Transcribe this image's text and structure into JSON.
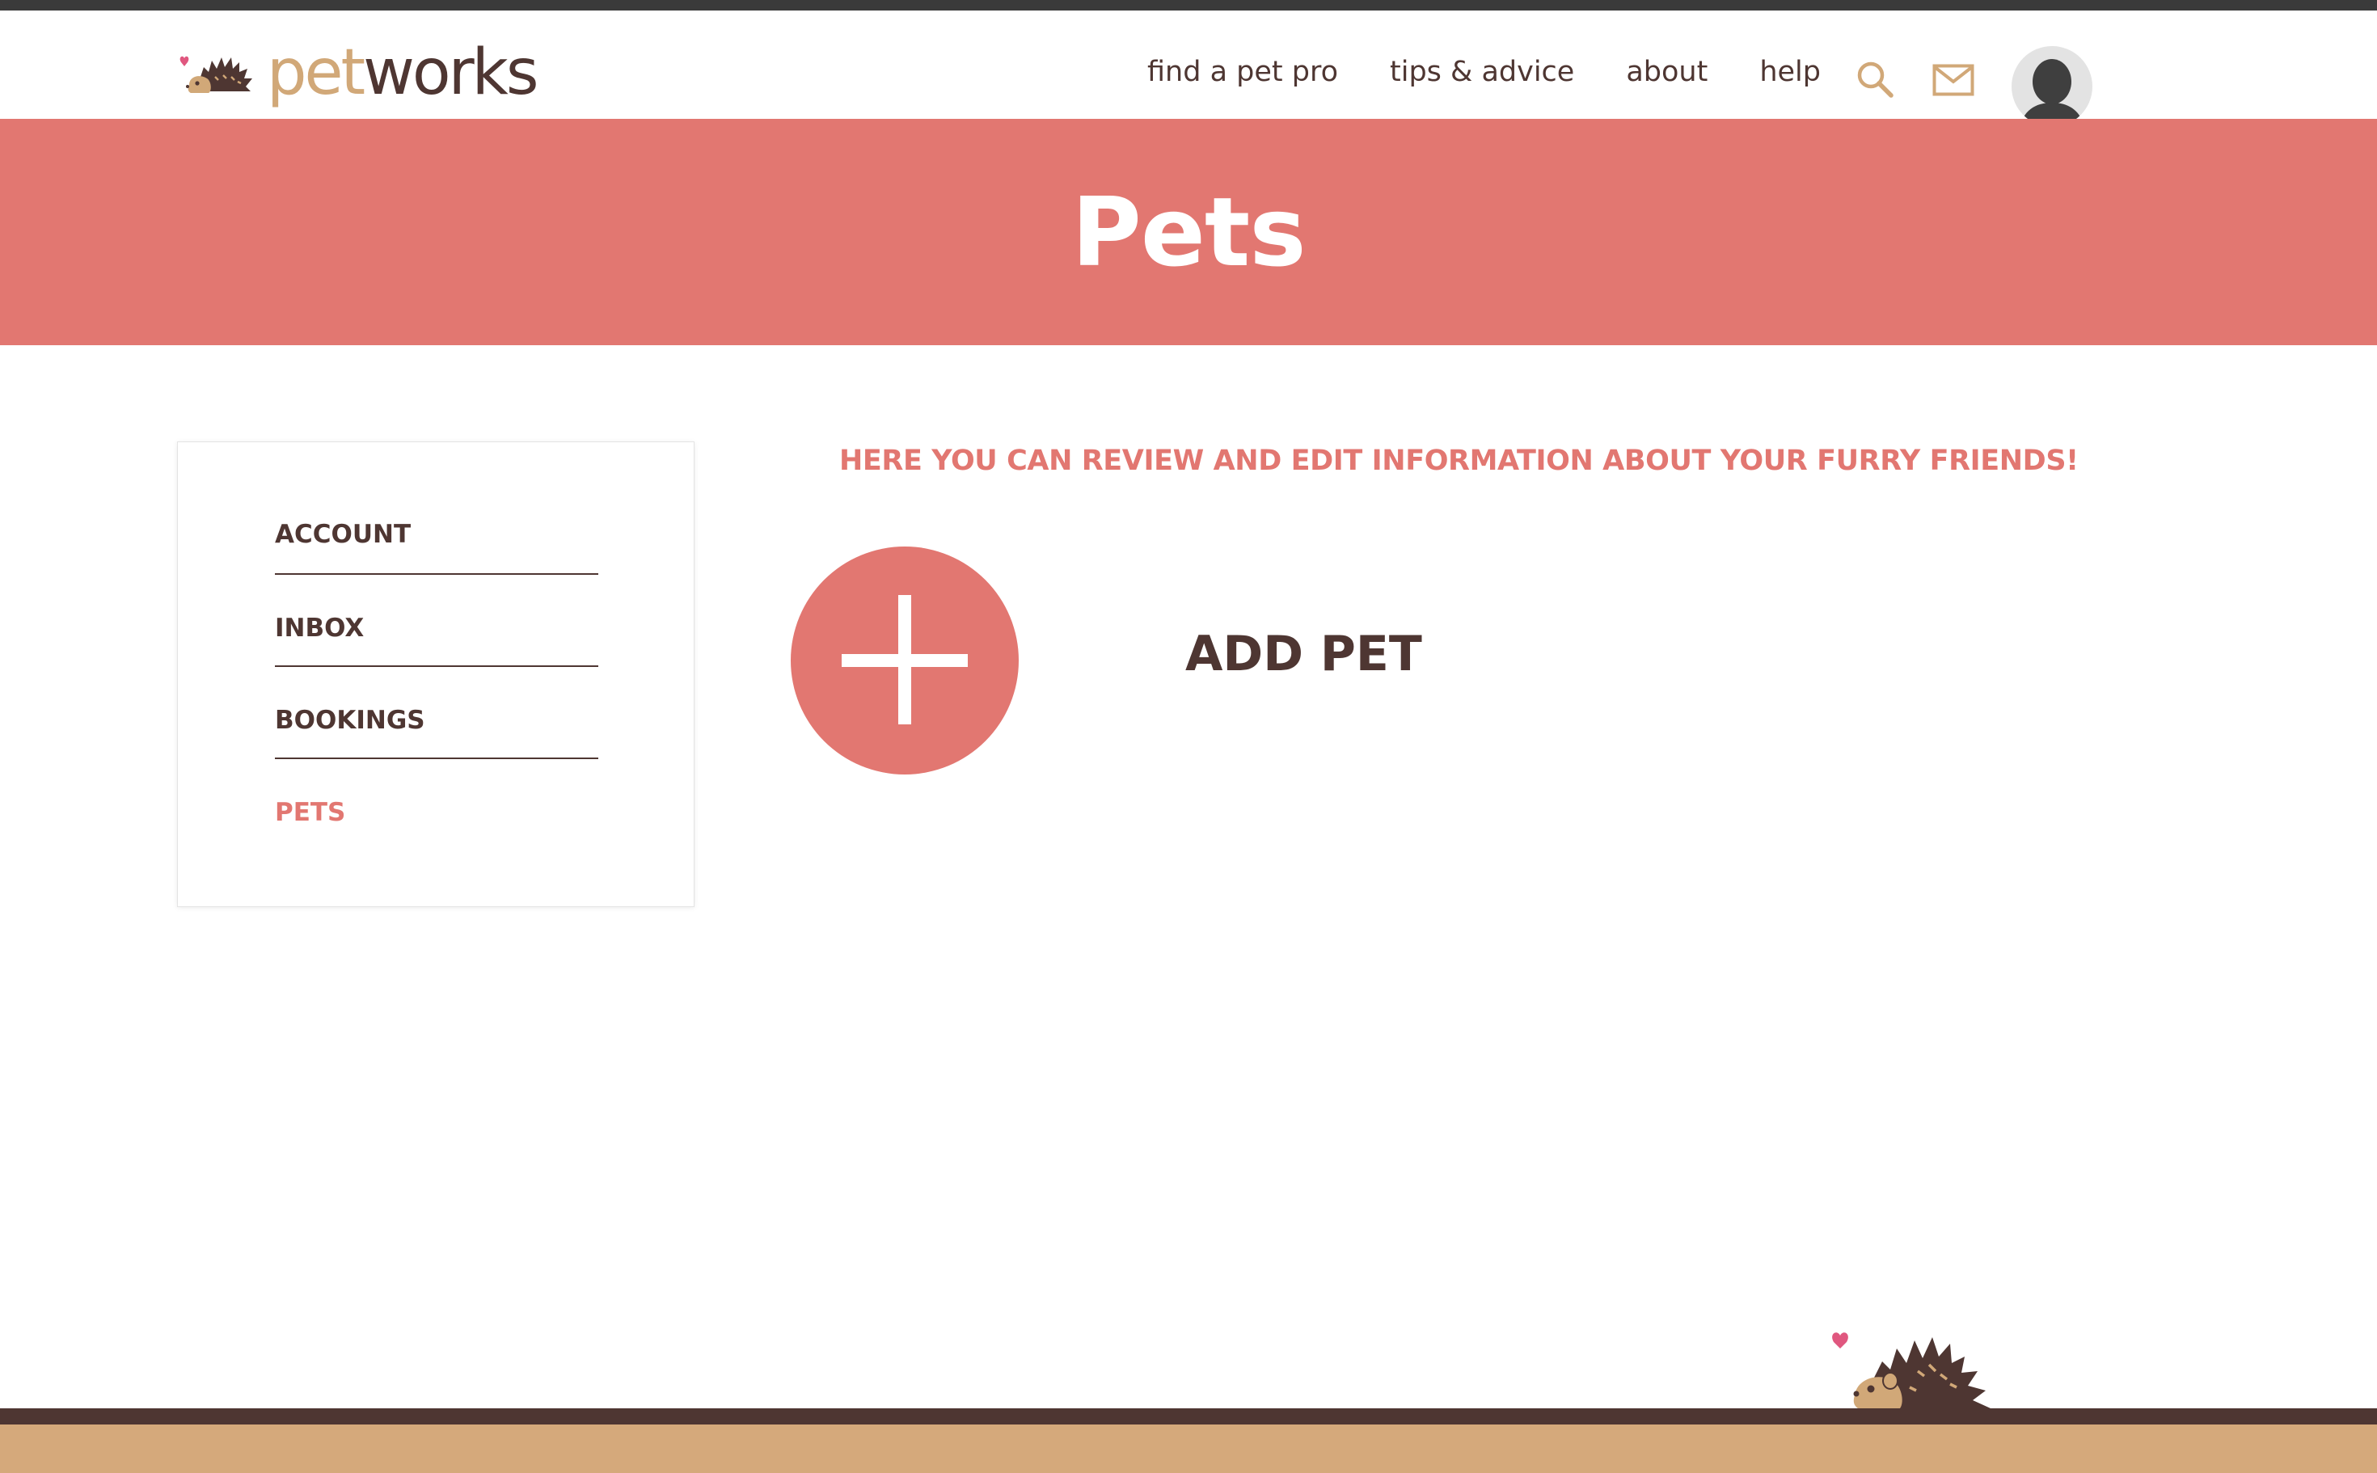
{
  "brand": {
    "logo_part1": "pet",
    "logo_part2": "works"
  },
  "nav": {
    "items": [
      {
        "label": "find a pet pro"
      },
      {
        "label": "tips & advice"
      },
      {
        "label": "about"
      },
      {
        "label": "help"
      }
    ],
    "icons": [
      "search-icon",
      "mail-icon",
      "avatar-icon"
    ]
  },
  "banner": {
    "title": "Pets"
  },
  "sidebar": {
    "items": [
      {
        "label": "ACCOUNT",
        "active": false
      },
      {
        "label": "INBOX",
        "active": false
      },
      {
        "label": "BOOKINGS",
        "active": false
      },
      {
        "label": "PETS",
        "active": true
      }
    ]
  },
  "main": {
    "intro": "HERE YOU CAN REVIEW AND EDIT INFORMATION ABOUT YOUR FURRY FRIENDS!",
    "add_pet_label": "ADD PET"
  },
  "colors": {
    "accent": "#e27771",
    "brown": "#4e3632",
    "tan": "#d1a878",
    "footer_tan": "#d5a97b"
  }
}
